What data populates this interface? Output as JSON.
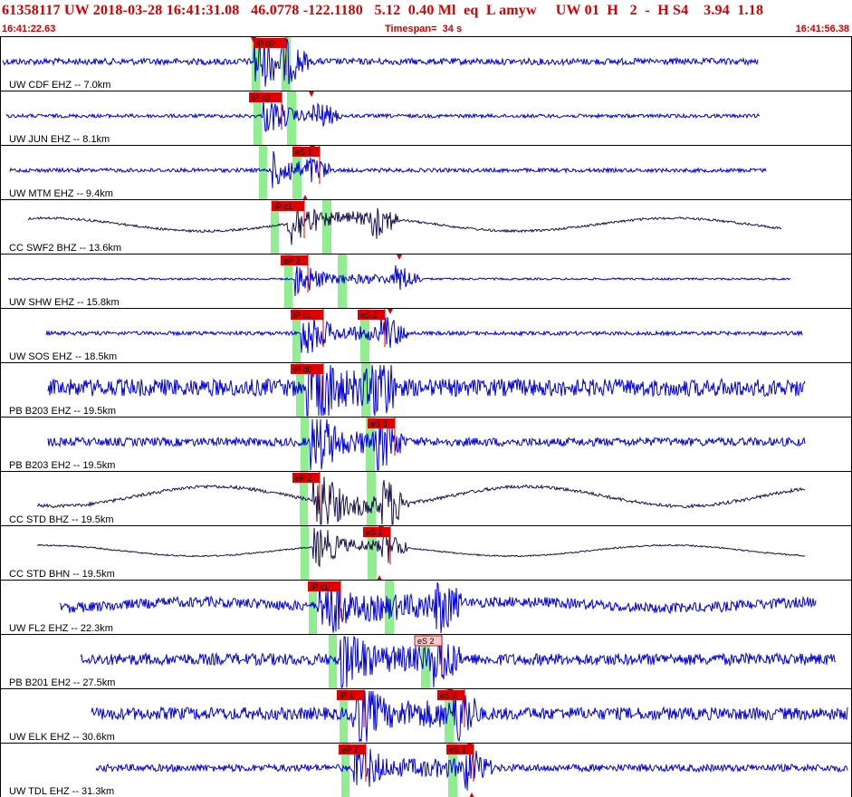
{
  "header": {
    "title": "61358117 UW 2018-03-28 16:41:31.08   46.0778 -122.1180   5.12  0.40 Ml  eq  L amyw     UW 01  H   2  -  H S4    3.94  1.18",
    "start_time": "16:41:22.63",
    "timespan": "Timespan=  34 s",
    "end_time": "16:41:56.38"
  },
  "colors": {
    "trace_blue": "#0000dd",
    "trace_dark": "#1a1050",
    "pick_red": "#e00000",
    "pick_pale": "#ffc8c8",
    "window_green": "#90ee90",
    "header_red": "#d40000"
  },
  "traces": [
    {
      "label": "UW CDF EHZ -- 7.0km",
      "color": "blue",
      "picks": [
        {
          "text": "iP c0",
          "style": "red"
        }
      ]
    },
    {
      "label": "UW JUN EHZ -- 8.1km",
      "color": "blue",
      "picks": [
        {
          "text": "iP c0",
          "style": "red"
        }
      ]
    },
    {
      "label": "UW MTM EHZ -- 9.4km",
      "color": "blue",
      "picks": [
        {
          "text": "eS 1",
          "style": "red"
        }
      ]
    },
    {
      "label": "CC SWF2 BHZ -- 13.6km",
      "color": "dark",
      "picks": [
        {
          "text": "iP c1",
          "style": "red"
        }
      ]
    },
    {
      "label": "UW SHW EHZ -- 15.8km",
      "color": "blue",
      "picks": [
        {
          "text": "eP 2",
          "style": "red"
        }
      ]
    },
    {
      "label": "UW SOS EHZ -- 18.5km",
      "color": "blue",
      "picks": [
        {
          "text": "iP c1",
          "style": "red"
        },
        {
          "text": "eS 2",
          "style": "red"
        }
      ]
    },
    {
      "label": "PB B203 EHZ -- 19.5km",
      "color": "blue",
      "picks": [
        {
          "text": "iP d0",
          "style": "red"
        }
      ]
    },
    {
      "label": "PB B203 EH2 -- 19.5km",
      "color": "blue",
      "picks": [
        {
          "text": "eS 3",
          "style": "red"
        }
      ]
    },
    {
      "label": "CC STD BHZ -- 19.5km",
      "color": "dark",
      "picks": [
        {
          "text": "eP 2",
          "style": "red"
        }
      ]
    },
    {
      "label": "CC STD BHN -- 19.5km",
      "color": "dark",
      "picks": [
        {
          "text": "eS 2",
          "style": "red"
        }
      ]
    },
    {
      "label": "UW FL2 EHZ -- 22.3km",
      "color": "blue",
      "picks": [
        {
          "text": "iP c1",
          "style": "red"
        }
      ]
    },
    {
      "label": "PB B201 EH2 -- 27.5km",
      "color": "blue",
      "picks": [
        {
          "text": "eS 2",
          "style": "pale"
        }
      ]
    },
    {
      "label": "UW ELK EHZ -- 30.6km",
      "color": "blue",
      "picks": [
        {
          "text": "iP 1",
          "style": "red"
        },
        {
          "text": "eS 2",
          "style": "red"
        }
      ]
    },
    {
      "label": "UW TDL EHZ -- 31.3km",
      "color": "blue",
      "picks": [
        {
          "text": "eP 2",
          "style": "red"
        },
        {
          "text": "eS 1",
          "style": "red"
        }
      ]
    }
  ]
}
